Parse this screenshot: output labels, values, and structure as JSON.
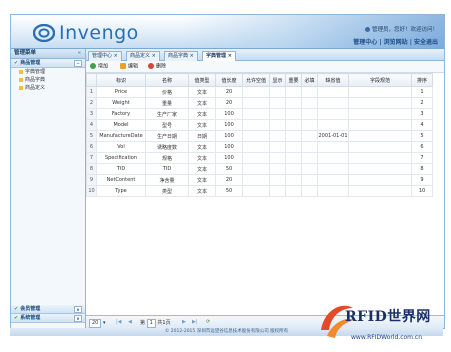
{
  "header": {
    "brand": "Invengo",
    "user_bar": "管理员，您好！欢迎访问！",
    "top_links": "管理中心 | 浏览网站 | 安全退出"
  },
  "sidebar": {
    "title": "管理菜单",
    "groups": [
      {
        "label": "商品管理",
        "items": [
          "字典管理",
          "商品字典",
          "商品定义"
        ]
      },
      {
        "label": "会员管理"
      },
      {
        "label": "系统管理"
      }
    ]
  },
  "tabs": [
    "管理中心",
    "商品定义",
    "商品字典",
    "字典管理"
  ],
  "toolbar": {
    "add": "增加",
    "edit": "编辑",
    "delete": "删除"
  },
  "table": {
    "columns": [
      "标识",
      "名称",
      "值类型",
      "值长度",
      "允许空值",
      "显示",
      "重要",
      "必填",
      "缺省值",
      "字段规范",
      "排序"
    ],
    "rows": [
      {
        "n": "1",
        "id": "Price",
        "name": "价格",
        "type": "文本",
        "len": "20",
        "def": "",
        "sort": "1"
      },
      {
        "n": "2",
        "id": "Weight",
        "name": "重量",
        "type": "文本",
        "len": "20",
        "def": "",
        "sort": "2"
      },
      {
        "n": "3",
        "id": "Factory",
        "name": "生产厂家",
        "type": "文本",
        "len": "100",
        "def": "",
        "sort": "3"
      },
      {
        "n": "4",
        "id": "Model",
        "name": "型号",
        "type": "文本",
        "len": "100",
        "def": "",
        "sort": "4"
      },
      {
        "n": "5",
        "id": "ManufactureDate",
        "name": "生产日期",
        "type": "日期",
        "len": "100",
        "def": "2001-01-01",
        "sort": "5"
      },
      {
        "n": "6",
        "id": "Vol",
        "name": "诱略度数",
        "type": "文本",
        "len": "100",
        "def": "",
        "sort": "6"
      },
      {
        "n": "7",
        "id": "Specification",
        "name": "规格",
        "type": "文本",
        "len": "100",
        "def": "",
        "sort": "7"
      },
      {
        "n": "8",
        "id": "TID",
        "name": "TID",
        "type": "文本",
        "len": "50",
        "def": "",
        "sort": "8"
      },
      {
        "n": "9",
        "id": "NetContent",
        "name": "净含量",
        "type": "文本",
        "len": "20",
        "def": "",
        "sort": "9"
      },
      {
        "n": "10",
        "id": "Type",
        "name": "类型",
        "type": "文本",
        "len": "50",
        "def": "",
        "sort": "10"
      }
    ]
  },
  "pager": {
    "page_size": "20",
    "page_label": "第",
    "page_value": "1",
    "page_total": "共1页"
  },
  "footer": "© 2012-2015 深圳市远望谷信息技术股份有限公司  版权所有",
  "watermark": {
    "main": "RFID世界网",
    "sub": "www.RFIDWorld.com.cn"
  },
  "colors": {
    "brand": "#2a6fb5",
    "border": "#8fb6d8",
    "header_bg": "#c7ddf2"
  }
}
